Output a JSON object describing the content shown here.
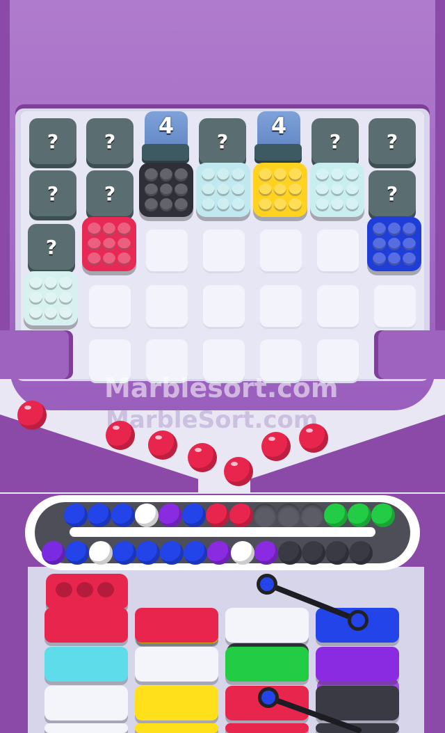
{
  "watermark": {
    "primary": "Marblesort.com",
    "secondary": "MarbleSort.com"
  },
  "board": {
    "hidden_label": "?",
    "counters": [
      {
        "value": "4"
      },
      {
        "value": "4"
      }
    ],
    "crates": [
      {
        "color": "#2f2f3a",
        "name": "black"
      },
      {
        "color": "#bfe9ee",
        "name": "white"
      },
      {
        "color": "#ffd21f",
        "name": "yellow"
      },
      {
        "color": "#c8eef0",
        "name": "white"
      },
      {
        "color": "#e62a55",
        "name": "red"
      },
      {
        "color": "#1f3ed8",
        "name": "blue"
      },
      {
        "color": "#d6f1ef",
        "name": "white"
      }
    ]
  },
  "falling_marbles_color": "#e8254d",
  "conveyor": {
    "top_row": [
      "#2244e8",
      "#2244e8",
      "#2244e8",
      "#ffffff",
      "#8a2be2",
      "#2244e8",
      "#e8254d",
      "#e8254d",
      "empty",
      "empty",
      "empty",
      "#22cc44",
      "#22cc44",
      "#22cc44"
    ],
    "bottom_row": [
      "#7a2be2",
      "#2244e8",
      "#ffffff",
      "#2244e8",
      "#2244e8",
      "#2244e8",
      "#2244e8",
      "#8a2be2",
      "#ffffff",
      "#8a2be2",
      "#3a3a44",
      "#3a3a44",
      "#3a3a44",
      "#3a3a44"
    ]
  },
  "tubes": [
    {
      "top": "#e8254d",
      "blocks": [
        "#e8254d",
        "#5fdcea",
        "#f4f4fb"
      ]
    },
    {
      "top": "#ffe01a",
      "blocks": [
        "#e8254d",
        "#f4f4fb",
        "#ffe01a"
      ]
    },
    {
      "top": "#3a3a44",
      "blocks": [
        "#f4f4fb",
        "#22cc44",
        "#e8254d"
      ]
    },
    {
      "top": "#a24ce0",
      "blocks": [
        "#2244e8",
        "#8a2be2",
        "#3a3a44"
      ]
    }
  ]
}
